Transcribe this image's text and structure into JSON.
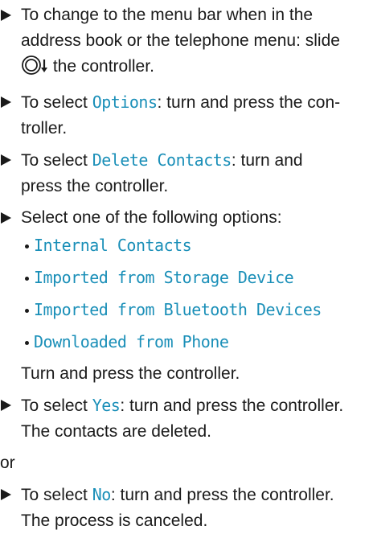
{
  "step1": {
    "line1": "To change to the menu bar when in the",
    "line2": "address book or the telephone menu: slide",
    "line3_suffix": " the controller."
  },
  "step2": {
    "prefix": "To select ",
    "option": "Options",
    "suffix": ": turn and press the con-",
    "line2": "troller."
  },
  "step3": {
    "prefix": "To select ",
    "option": "Delete Contacts",
    "suffix": ": turn and",
    "line2": "press the controller."
  },
  "step4": {
    "text": "Select one of the following options:",
    "options": [
      "Internal Contacts",
      "Imported from Storage Device",
      "Imported from Bluetooth Devices",
      "Downloaded from Phone"
    ],
    "after": "Turn and press the controller."
  },
  "step5": {
    "prefix": "To select ",
    "option": "Yes",
    "suffix": ": turn and press the controller.",
    "line2": "The contacts are deleted."
  },
  "or_text": "or",
  "step6": {
    "prefix": "To select ",
    "option": "No",
    "suffix": ": turn and press the controller.",
    "line2": "The process is canceled."
  },
  "colors": {
    "option_text": "#1a8fb8",
    "body_text": "#1a1a1a"
  },
  "icons": {
    "step_marker": "triangle-right-icon",
    "controller": "controller-slide-down-icon"
  }
}
